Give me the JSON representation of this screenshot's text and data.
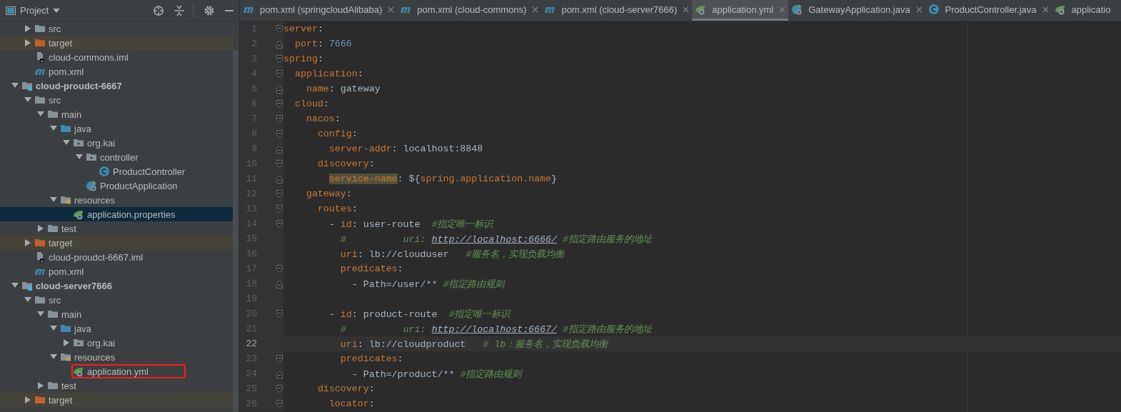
{
  "project_panel": {
    "title": "Project"
  },
  "tree": {
    "continued_items": [
      {
        "label": "src",
        "kind": "folder",
        "expanded": false,
        "selected": false
      },
      {
        "label": "target",
        "kind": "excluded-folder",
        "expanded": false,
        "selected": false
      },
      {
        "label": "cloud-commons.iml",
        "kind": "iml",
        "selected": false
      },
      {
        "label": "pom.xml",
        "kind": "maven",
        "selected": false
      }
    ],
    "items": [
      {
        "label": "cloud-proudct-6667",
        "kind": "module",
        "expanded": true,
        "selected": false,
        "children": [
          {
            "label": "src",
            "kind": "folder",
            "expanded": true,
            "selected": false,
            "children": [
              {
                "label": "main",
                "kind": "folder",
                "expanded": true,
                "selected": false,
                "children": [
                  {
                    "label": "java",
                    "kind": "source-folder",
                    "expanded": true,
                    "selected": false,
                    "children": [
                      {
                        "label": "org.kai",
                        "kind": "package",
                        "expanded": true,
                        "selected": false,
                        "children": [
                          {
                            "label": "controller",
                            "kind": "package",
                            "expanded": true,
                            "selected": false,
                            "children": [
                              {
                                "label": "ProductController",
                                "kind": "class",
                                "selected": false
                              }
                            ]
                          },
                          {
                            "label": "ProductApplication",
                            "kind": "spring-boot",
                            "selected": false
                          }
                        ]
                      }
                    ]
                  },
                  {
                    "label": "resources",
                    "kind": "resources-folder",
                    "expanded": true,
                    "selected": false,
                    "children": [
                      {
                        "label": "application.properties",
                        "kind": "spring-config",
                        "selected": true
                      }
                    ]
                  }
                ]
              },
              {
                "label": "test",
                "kind": "folder",
                "expanded": false,
                "selected": false
              }
            ]
          },
          {
            "label": "target",
            "kind": "excluded-folder",
            "expanded": false,
            "selected": false
          },
          {
            "label": "cloud-proudct-6667.iml",
            "kind": "iml",
            "selected": false
          },
          {
            "label": "pom.xml",
            "kind": "maven",
            "selected": false
          }
        ]
      },
      {
        "label": "cloud-server7666",
        "kind": "module",
        "expanded": true,
        "selected": false,
        "children": [
          {
            "label": "src",
            "kind": "folder",
            "expanded": true,
            "selected": false,
            "children": [
              {
                "label": "main",
                "kind": "folder",
                "expanded": true,
                "selected": false,
                "children": [
                  {
                    "label": "java",
                    "kind": "source-folder",
                    "expanded": true,
                    "selected": false,
                    "children": [
                      {
                        "label": "org.kai",
                        "kind": "package",
                        "expanded": false,
                        "selected": false
                      }
                    ]
                  },
                  {
                    "label": "resources",
                    "kind": "resources-folder",
                    "expanded": true,
                    "selected": false,
                    "children": [
                      {
                        "label": "application.yml",
                        "kind": "spring-config",
                        "selected": false,
                        "marked": true
                      }
                    ]
                  }
                ]
              },
              {
                "label": "test",
                "kind": "folder",
                "expanded": false,
                "selected": false
              }
            ]
          },
          {
            "label": "target",
            "kind": "excluded-folder",
            "expanded": false,
            "selected": false
          }
        ]
      }
    ]
  },
  "tabs": [
    {
      "label": "pom.xml (springcloudAlibaba)",
      "kind": "maven",
      "selected": false,
      "closable": true
    },
    {
      "label": "pom.xml (cloud-commons)",
      "kind": "maven",
      "selected": false,
      "closable": true
    },
    {
      "label": "pom.xml (cloud-server7666)",
      "kind": "maven",
      "selected": false,
      "closable": true
    },
    {
      "label": "application.yml",
      "kind": "spring-config",
      "selected": true,
      "closable": true
    },
    {
      "label": "GatewayApplication.java",
      "kind": "spring-boot",
      "selected": false,
      "closable": true
    },
    {
      "label": "ProductController.java",
      "kind": "class",
      "selected": false,
      "closable": true
    },
    {
      "label": "applicatio",
      "kind": "spring-config",
      "selected": false,
      "closable": false
    }
  ],
  "editor": {
    "lines": [
      {
        "number": "1",
        "kind": "fold-start",
        "tokens": [
          {
            "t": "server",
            "kind": "key"
          },
          {
            "t": ":",
            "kind": "plain"
          }
        ]
      },
      {
        "number": "2",
        "kind": "fold-end",
        "tokens": [
          {
            "t": "  port",
            "kind": "key"
          },
          {
            "t": ": ",
            "kind": "plain"
          },
          {
            "t": "7666",
            "kind": "number"
          }
        ]
      },
      {
        "number": "3",
        "kind": "fold-start",
        "tokens": [
          {
            "t": "spring",
            "kind": "key"
          },
          {
            "t": ":",
            "kind": "plain"
          }
        ]
      },
      {
        "number": "4",
        "kind": "fold-start",
        "tokens": [
          {
            "t": "  application",
            "kind": "key"
          },
          {
            "t": ":",
            "kind": "plain"
          }
        ]
      },
      {
        "number": "5",
        "kind": "fold-end",
        "tokens": [
          {
            "t": "    name",
            "kind": "key"
          },
          {
            "t": ": gateway",
            "kind": "plain"
          }
        ]
      },
      {
        "number": "6",
        "kind": "fold-start",
        "tokens": [
          {
            "t": "  cloud",
            "kind": "key"
          },
          {
            "t": ":",
            "kind": "plain"
          }
        ]
      },
      {
        "number": "7",
        "kind": "fold-start",
        "tokens": [
          {
            "t": "    nacos",
            "kind": "key"
          },
          {
            "t": ":",
            "kind": "plain"
          }
        ]
      },
      {
        "number": "8",
        "kind": "fold-start",
        "tokens": [
          {
            "t": "      config",
            "kind": "key"
          },
          {
            "t": ":",
            "kind": "plain"
          }
        ]
      },
      {
        "number": "9",
        "kind": "fold-end",
        "tokens": [
          {
            "t": "        server-addr",
            "kind": "key"
          },
          {
            "t": ": localhost:8848",
            "kind": "plain"
          }
        ]
      },
      {
        "number": "10",
        "kind": "fold-start",
        "tokens": [
          {
            "t": "      discovery",
            "kind": "key"
          },
          {
            "t": ":",
            "kind": "plain"
          }
        ]
      },
      {
        "number": "11",
        "kind": "fold-end",
        "tokens": [
          {
            "t": "        service-name",
            "kind": "highlight"
          },
          {
            "t": ": ${",
            "kind": "plain"
          },
          {
            "t": "spring.application.name",
            "kind": "key"
          },
          {
            "t": "}",
            "kind": "plain"
          }
        ]
      },
      {
        "number": "12",
        "kind": "fold-start",
        "tokens": [
          {
            "t": "    gateway",
            "kind": "key"
          },
          {
            "t": ":",
            "kind": "plain"
          }
        ]
      },
      {
        "number": "13",
        "kind": "fold-start",
        "tokens": [
          {
            "t": "      routes",
            "kind": "key"
          },
          {
            "t": ":",
            "kind": "plain"
          }
        ]
      },
      {
        "number": "14",
        "kind": "fold-start",
        "tokens": [
          {
            "t": "        - ",
            "kind": "plain"
          },
          {
            "t": "id",
            "kind": "key"
          },
          {
            "t": ": user-route  ",
            "kind": "plain"
          },
          {
            "t": "#指定唯一标识",
            "kind": "comment"
          }
        ]
      },
      {
        "number": "15",
        "kind": "plain",
        "tokens": [
          {
            "t": "          #          uri: ",
            "kind": "comment"
          },
          {
            "t": "http://localhost:6666/",
            "kind": "link"
          },
          {
            "t": " #指定路由服务的地址",
            "kind": "comment"
          }
        ]
      },
      {
        "number": "16",
        "kind": "plain",
        "tokens": [
          {
            "t": "          uri",
            "kind": "key"
          },
          {
            "t": ": lb://clouduser   ",
            "kind": "plain"
          },
          {
            "t": "#服务名，实现负载均衡",
            "kind": "comment"
          }
        ]
      },
      {
        "number": "17",
        "kind": "fold-start",
        "tokens": [
          {
            "t": "          predicates",
            "kind": "key"
          },
          {
            "t": ":",
            "kind": "plain"
          }
        ]
      },
      {
        "number": "18",
        "kind": "fold-end",
        "tokens": [
          {
            "t": "            - Path=/user/** ",
            "kind": "plain"
          },
          {
            "t": "#指定路由规则",
            "kind": "comment"
          }
        ]
      },
      {
        "number": "19",
        "kind": "plain"
      },
      {
        "number": "20",
        "kind": "fold-start",
        "tokens": [
          {
            "t": "        - ",
            "kind": "plain"
          },
          {
            "t": "id",
            "kind": "key"
          },
          {
            "t": ": product-route  ",
            "kind": "plain"
          },
          {
            "t": "#指定唯一标识",
            "kind": "comment"
          }
        ]
      },
      {
        "number": "21",
        "kind": "plain",
        "tokens": [
          {
            "t": "          #          uri: ",
            "kind": "comment"
          },
          {
            "t": "http://localhost:6667/",
            "kind": "link"
          },
          {
            "t": " #指定路由服务的地址",
            "kind": "comment"
          }
        ]
      },
      {
        "number": "22",
        "kind": "plain",
        "current": true,
        "tokens": [
          {
            "t": "          uri",
            "kind": "key"
          },
          {
            "t": ": lb://cloudproduct   ",
            "kind": "plain"
          },
          {
            "t": "# lb：服务名，实现负载均衡",
            "kind": "comment"
          }
        ]
      },
      {
        "number": "23",
        "kind": "fold-start",
        "tokens": [
          {
            "t": "          predicates",
            "kind": "key"
          },
          {
            "t": ":",
            "kind": "plain"
          }
        ]
      },
      {
        "number": "24",
        "kind": "fold-end",
        "tokens": [
          {
            "t": "            - Path=/product/** ",
            "kind": "plain"
          },
          {
            "t": "#指定路由规则",
            "kind": "comment"
          }
        ]
      },
      {
        "number": "25",
        "kind": "fold-start",
        "tokens": [
          {
            "t": "      discovery",
            "kind": "key"
          },
          {
            "t": ":",
            "kind": "plain"
          }
        ]
      },
      {
        "number": "26",
        "kind": "fold-start",
        "tokens": [
          {
            "t": "        locator",
            "kind": "key"
          },
          {
            "t": ":",
            "kind": "plain"
          }
        ]
      }
    ]
  }
}
